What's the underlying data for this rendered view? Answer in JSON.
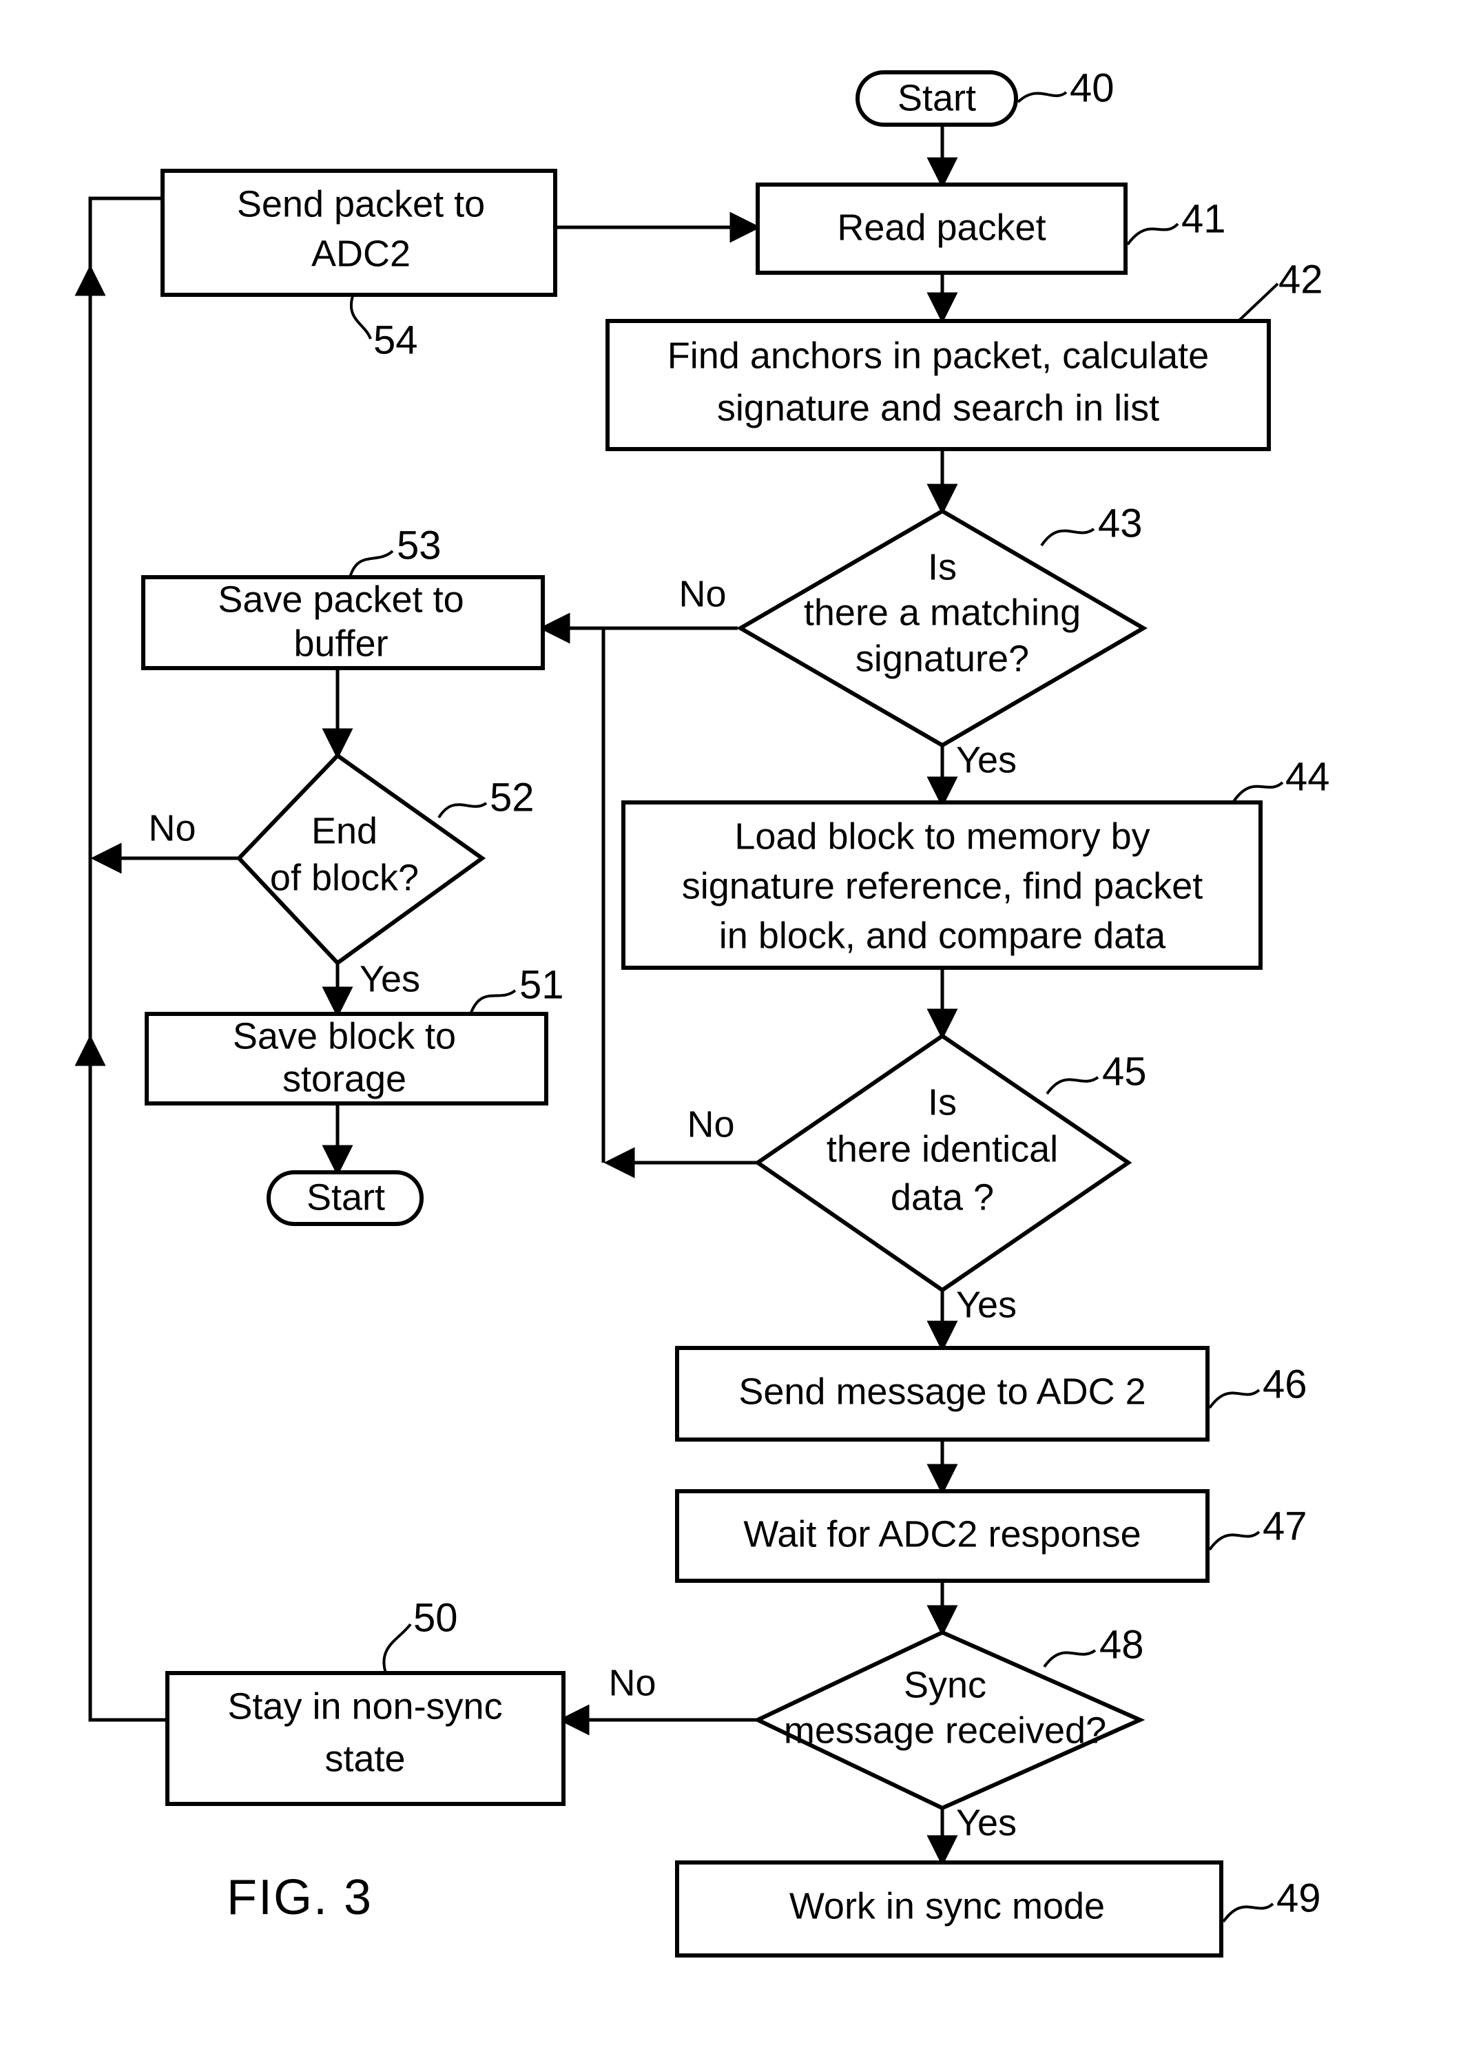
{
  "figure": {
    "caption": "FIG. 3",
    "type": "patent-flowchart"
  },
  "nodes": {
    "start_top": {
      "label": "Start",
      "ref": "40",
      "shape": "terminator"
    },
    "read_packet": {
      "label": "Read packet",
      "ref": "41",
      "shape": "process"
    },
    "find_anchors_l1": {
      "label": "Find anchors in packet, calculate",
      "ref": "42",
      "shape": "process"
    },
    "find_anchors_l2": {
      "label": "signature and search in list"
    },
    "matching_sig_l1": {
      "label": "Is",
      "ref": "43",
      "shape": "decision"
    },
    "matching_sig_l2": {
      "label": "there a matching"
    },
    "matching_sig_l3": {
      "label": "signature?"
    },
    "load_block_l1": {
      "label": "Load block to memory by",
      "ref": "44",
      "shape": "process"
    },
    "load_block_l2": {
      "label": "signature reference, find packet"
    },
    "load_block_l3": {
      "label": "in block, and compare data"
    },
    "identical_data_l1": {
      "label": "Is",
      "ref": "45",
      "shape": "decision"
    },
    "identical_data_l2": {
      "label": "there identical"
    },
    "identical_data_l3": {
      "label": "data ?"
    },
    "send_message": {
      "label": "Send message to ADC 2",
      "ref": "46",
      "shape": "process"
    },
    "wait_response": {
      "label": "Wait for ADC2 response",
      "ref": "47",
      "shape": "process"
    },
    "sync_received_l1": {
      "label": "Sync",
      "ref": "48",
      "shape": "decision"
    },
    "sync_received_l2": {
      "label": "message received?"
    },
    "work_sync": {
      "label": "Work in sync mode",
      "ref": "49",
      "shape": "process"
    },
    "stay_nonsync_l1": {
      "label": "Stay in non-sync",
      "ref": "50",
      "shape": "process"
    },
    "stay_nonsync_l2": {
      "label": "state"
    },
    "save_block_l1": {
      "label": "Save block to",
      "ref": "51",
      "shape": "process"
    },
    "save_block_l2": {
      "label": "storage"
    },
    "end_of_block_l1": {
      "label": "End",
      "ref": "52",
      "shape": "decision"
    },
    "end_of_block_l2": {
      "label": "of block?"
    },
    "save_packet_l1": {
      "label": "Save packet to",
      "ref": "53",
      "shape": "process"
    },
    "save_packet_l2": {
      "label": "buffer"
    },
    "send_packet_l1": {
      "label": "Send packet to",
      "ref": "54",
      "shape": "process"
    },
    "send_packet_l2": {
      "label": "ADC2"
    },
    "start_bottom": {
      "label": "Start",
      "shape": "terminator"
    }
  },
  "edge_labels": {
    "sig_no": "No",
    "sig_yes": "Yes",
    "data_no": "No",
    "data_yes": "Yes",
    "sync_no": "No",
    "sync_yes": "Yes",
    "block_no": "No",
    "block_yes": "Yes"
  },
  "colors": {
    "stroke": "#000000",
    "fill": "#ffffff",
    "text": "#000000"
  }
}
